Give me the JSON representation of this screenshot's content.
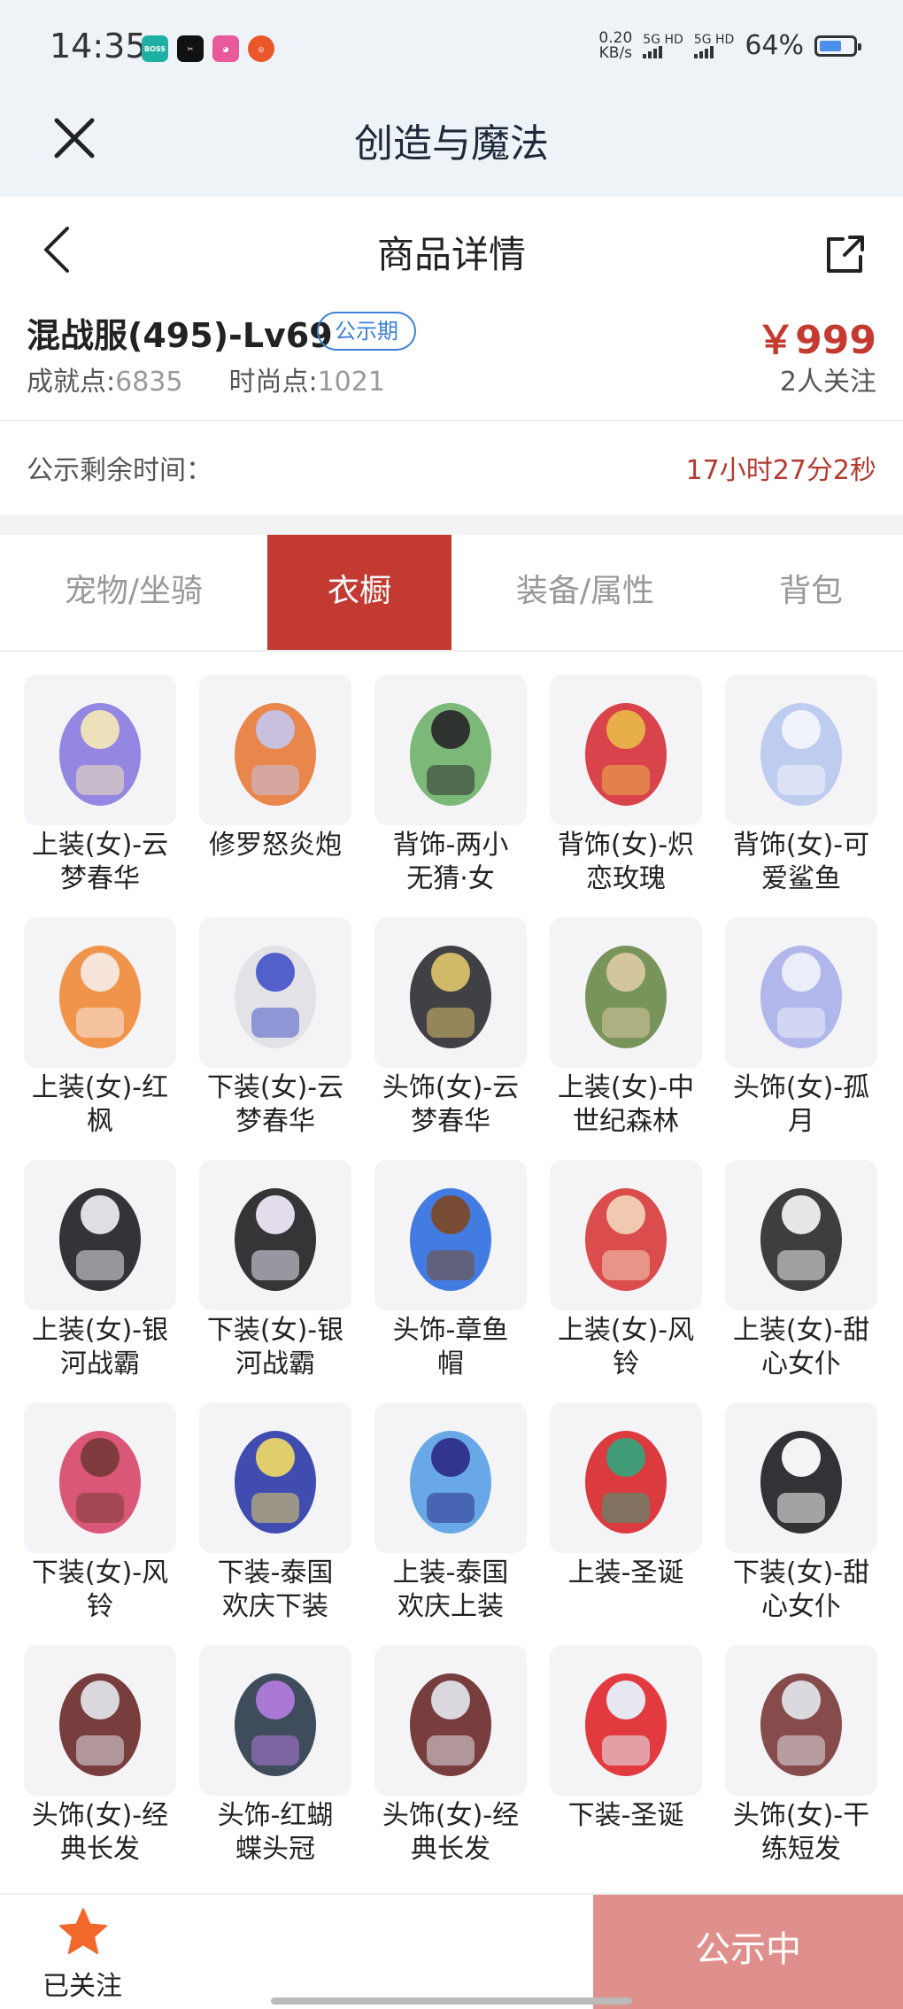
{
  "status": {
    "time": "14:35",
    "net_speed_value": "0.20",
    "net_speed_unit": "KB/s",
    "sim1": "5G HD",
    "sim2": "5G HD",
    "battery": "64%",
    "battery_level": 0.64,
    "app_icons": [
      "boss-zhipin-icon",
      "capcut-icon",
      "dewu-icon",
      "pumpkin-app-icon"
    ]
  },
  "appbar": {
    "title": "创造与魔法"
  },
  "nav": {
    "title": "商品详情"
  },
  "product": {
    "name": "混战服(495)-Lv69",
    "badge": "公示期",
    "achievement_label": "成就点:",
    "achievement_value": "6835",
    "fashion_label": "时尚点:",
    "fashion_value": "1021",
    "price": "￥999",
    "followers": "2人关注"
  },
  "countdown": {
    "label": "公示剩余时间：",
    "value": "17小时27分2秒"
  },
  "tabs": [
    {
      "label": "宠物/坐骑",
      "active": false
    },
    {
      "label": "衣橱",
      "active": true
    },
    {
      "label": "装备/属性",
      "active": false
    },
    {
      "label": "背包",
      "active": false
    }
  ],
  "wardrobe": [
    {
      "line1": "上装(女)-云",
      "line2": "梦春华"
    },
    {
      "line1": "修罗怒炎炮",
      "line2": ""
    },
    {
      "line1": "背饰-两小",
      "line2": "无猜·女"
    },
    {
      "line1": "背饰(女)-炽",
      "line2": "恋玫瑰"
    },
    {
      "line1": "背饰(女)-可",
      "line2": "爱鲨鱼"
    },
    {
      "line1": "上装(女)-红",
      "line2": "枫"
    },
    {
      "line1": "下装(女)-云",
      "line2": "梦春华"
    },
    {
      "line1": "头饰(女)-云",
      "line2": "梦春华"
    },
    {
      "line1": "上装(女)-中",
      "line2": "世纪森林"
    },
    {
      "line1": "头饰(女)-孤",
      "line2": "月"
    },
    {
      "line1": "上装(女)-银",
      "line2": "河战霸"
    },
    {
      "line1": "下装(女)-银",
      "line2": "河战霸"
    },
    {
      "line1": "头饰-章鱼",
      "line2": "帽"
    },
    {
      "line1": "上装(女)-风",
      "line2": "铃"
    },
    {
      "line1": "上装(女)-甜",
      "line2": "心女仆"
    },
    {
      "line1": "下装(女)-风",
      "line2": "铃"
    },
    {
      "line1": "下装-泰国",
      "line2": "欢庆下装"
    },
    {
      "line1": "上装-泰国",
      "line2": "欢庆上装"
    },
    {
      "line1": "上装-圣诞",
      "line2": ""
    },
    {
      "line1": "下装(女)-甜",
      "line2": "心女仆"
    },
    {
      "line1": "头饰(女)-经",
      "line2": "典长发"
    },
    {
      "line1": "头饰-红蝴",
      "line2": "蝶头冠"
    },
    {
      "line1": "头饰(女)-经",
      "line2": "典长发"
    },
    {
      "line1": "下装-圣诞",
      "line2": ""
    },
    {
      "line1": "头饰(女)-干",
      "line2": "练短发"
    }
  ],
  "bottom": {
    "follow_label": "已关注",
    "cta_label": "公示中"
  },
  "colors": {
    "accent": "#c23a32",
    "price": "#c53a30",
    "badge": "#3d7fd6",
    "cta": "#e0908c",
    "star": "#f2682a"
  }
}
